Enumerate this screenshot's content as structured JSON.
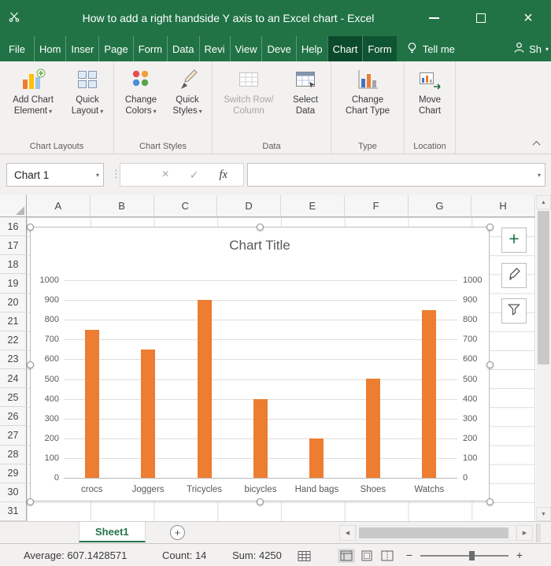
{
  "titlebar": {
    "title": "How to add a right handside Y axis to an Excel chart  -  Excel"
  },
  "window_controls": {
    "close": "×"
  },
  "tabs": [
    "File",
    "Hom",
    "Inser",
    "Page",
    "Form",
    "Data",
    "Revi",
    "View",
    "Deve",
    "Help",
    "Chart",
    "Form"
  ],
  "active_tab_index": 10,
  "contextual_tab_indices": [
    10,
    11
  ],
  "tell_me": "Tell me",
  "share_label": "Sh",
  "ribbon": {
    "groups": [
      {
        "name": "Chart Layouts",
        "buttons": [
          {
            "lines": [
              "Add Chart",
              "Element"
            ],
            "dropdown": true,
            "icon": "add-chart-element-icon"
          },
          {
            "lines": [
              "Quick",
              "Layout"
            ],
            "dropdown": true,
            "icon": "quick-layout-icon"
          }
        ]
      },
      {
        "name": "Chart Styles",
        "buttons": [
          {
            "lines": [
              "Change",
              "Colors"
            ],
            "dropdown": true,
            "icon": "change-colors-icon"
          },
          {
            "lines": [
              "Quick",
              "Styles"
            ],
            "dropdown": true,
            "icon": "quick-styles-icon"
          }
        ]
      },
      {
        "name": "Data",
        "buttons": [
          {
            "lines": [
              "Switch Row/",
              "Column"
            ],
            "disabled": true,
            "icon": "switch-row-column-icon"
          },
          {
            "lines": [
              "Select",
              "Data"
            ],
            "icon": "select-data-icon"
          }
        ]
      },
      {
        "name": "Type",
        "buttons": [
          {
            "lines": [
              "Change",
              "Chart Type"
            ],
            "icon": "change-chart-type-icon"
          }
        ]
      },
      {
        "name": "Location",
        "buttons": [
          {
            "lines": [
              "Move",
              "Chart"
            ],
            "icon": "move-chart-icon"
          }
        ]
      }
    ]
  },
  "formula_bar": {
    "name_box": "Chart 1",
    "fx_label": "fx",
    "formula_value": ""
  },
  "grid": {
    "columns": [
      "A",
      "B",
      "C",
      "D",
      "E",
      "F",
      "G",
      "H"
    ],
    "rows": [
      "16",
      "17",
      "18",
      "19",
      "20",
      "21",
      "22",
      "23",
      "24",
      "25",
      "26",
      "27",
      "28",
      "29",
      "30",
      "31"
    ]
  },
  "chart_data": {
    "type": "bar",
    "title": "Chart Title",
    "categories": [
      "crocs",
      "Joggers",
      "Tricycles",
      "bicycles",
      "Hand bags",
      "Shoes",
      "Watchs"
    ],
    "values": [
      750,
      650,
      900,
      400,
      200,
      500,
      850
    ],
    "bar_color": "#ED7D31",
    "ylim": [
      0,
      1000
    ],
    "y_tick_step": 100,
    "y_left_ticks": [
      "1000",
      "900",
      "800",
      "700",
      "600",
      "500",
      "400",
      "300",
      "200",
      "100",
      "0"
    ],
    "y_right_ticks": [
      "1000",
      "900",
      "800",
      "700",
      "600",
      "500",
      "400",
      "300",
      "200",
      "100",
      "0"
    ],
    "grid": true,
    "legend": "none",
    "secondary_y_axis": true
  },
  "sheet_tabs": {
    "active": "Sheet1"
  },
  "status_bar": {
    "average": {
      "label": "Average:",
      "value": "607.1428571"
    },
    "count": {
      "label": "Count:",
      "value": "14"
    },
    "sum": {
      "label": "Sum:",
      "value": "4250"
    }
  },
  "icons": {
    "dropdown": "▾",
    "plus": "+",
    "cancel": "×",
    "check": "✓",
    "separator_dots": "⋮",
    "scroll_up": "▲",
    "scroll_down": "▼",
    "scroll_left": "◀",
    "scroll_right": "▶",
    "zoom_out": "−",
    "zoom_in": "+"
  },
  "colors": {
    "excel_green": "#217346",
    "contextual_tab_green": "#0F5433",
    "bar_orange": "#ED7D31"
  }
}
